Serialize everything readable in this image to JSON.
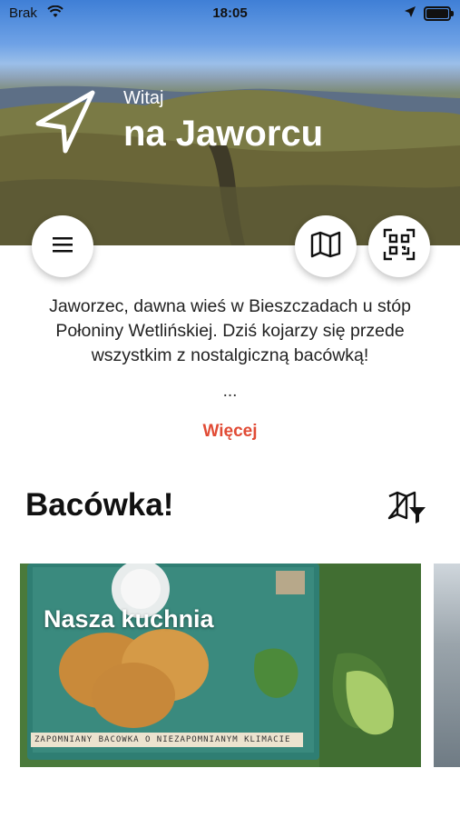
{
  "status_bar": {
    "carrier": "Brak",
    "time": "18:05"
  },
  "header": {
    "greeting": "Witaj",
    "place": "na Jaworcu"
  },
  "description": "Jaworzec, dawna wieś w Bieszczadach u stóp Połoniny Wetlińskiej. Dziś kojarzy się przede wszystkim z nostalgiczną bacówką!",
  "ellipsis": "...",
  "more_label": "Więcej",
  "section": {
    "title": "Bacówka!"
  },
  "cards": [
    {
      "title": "Nasza kuchnia",
      "caption": "ZAPOMNIANY BACÓWKA O NIEZAPOMNIANYM KLIMACIE"
    }
  ],
  "colors": {
    "accent": "#e14b35"
  },
  "icons": [
    "wifi-icon",
    "location-arrow-icon",
    "battery-icon",
    "navigation-logo-icon",
    "menu-icon",
    "map-icon",
    "qr-scan-icon",
    "map-filter-icon"
  ]
}
